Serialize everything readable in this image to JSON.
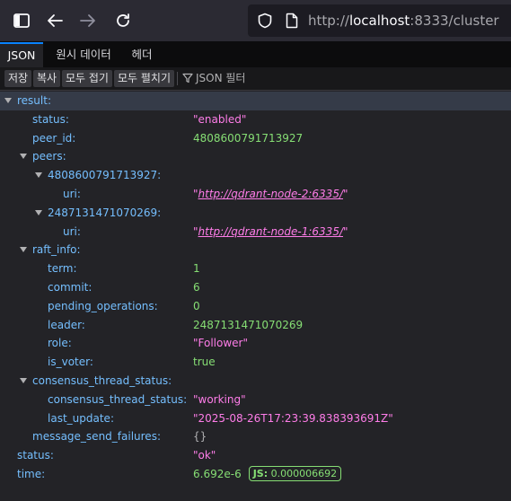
{
  "browser": {
    "url_host": "localhost",
    "url_scheme": "http://",
    "url_rest": ":8333/cluster"
  },
  "tabs": [
    "JSON",
    "원시 데이터",
    "헤더"
  ],
  "json_toolbar": {
    "save": "저장",
    "copy": "복사",
    "collapse_all": "모두 접기",
    "expand_all": "모두 펼치기",
    "filter_placeholder": "JSON 필터"
  },
  "tree": {
    "result_key": "result",
    "status_key": "status",
    "status_val": "\"enabled\"",
    "peer_id_key": "peer_id",
    "peer_id_val": "4808600791713927",
    "peers_key": "peers",
    "peer1_key": "4808600791713927",
    "peer1_uri_key": "uri",
    "peer1_uri_val": "http://qdrant-node-2:6335/",
    "peer2_key": "2487131471070269",
    "peer2_uri_key": "uri",
    "peer2_uri_val": "http://qdrant-node-1:6335/",
    "raft_info_key": "raft_info",
    "term_key": "term",
    "term_val": "1",
    "commit_key": "commit",
    "commit_val": "6",
    "pending_key": "pending_operations",
    "pending_val": "0",
    "leader_key": "leader",
    "leader_val": "2487131471070269",
    "role_key": "role",
    "role_val": "\"Follower\"",
    "is_voter_key": "is_voter",
    "is_voter_val": "true",
    "cts_key": "consensus_thread_status",
    "cts_inner_key": "consensus_thread_status",
    "cts_inner_val": "\"working\"",
    "last_update_key": "last_update",
    "last_update_val": "\"2025-08-26T17:23:39.838393691Z\"",
    "msf_key": "message_send_failures",
    "msf_val": "{}",
    "top_status_key": "status",
    "top_status_val": "\"ok\"",
    "time_key": "time",
    "time_val": "6.692e-6",
    "time_js_label": "JS:",
    "time_js_val": "0.000006692"
  }
}
